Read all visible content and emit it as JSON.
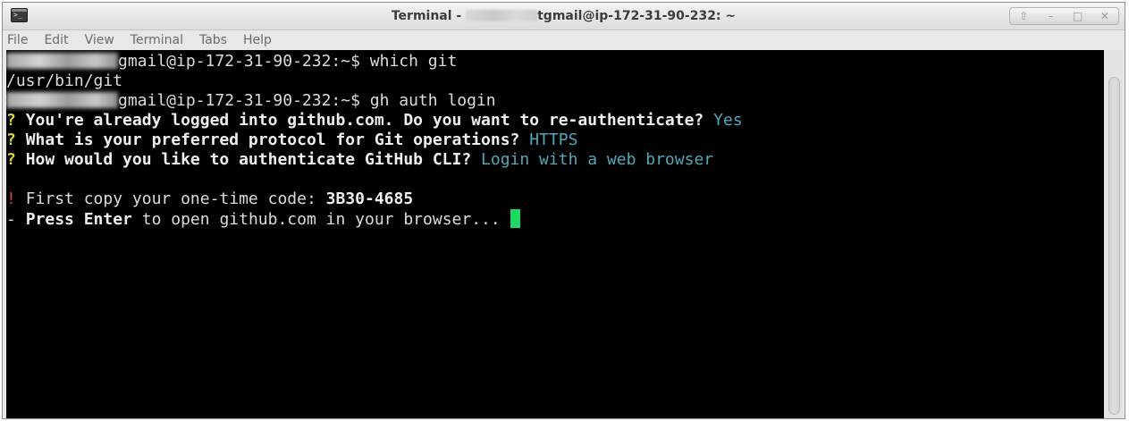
{
  "window": {
    "title_prefix": "Terminal - ",
    "title_suffix": "tgmail@ip-172-31-90-232: ~",
    "controls": [
      "⇧",
      "–",
      "□",
      "✕"
    ]
  },
  "menu": {
    "items": [
      "File",
      "Edit",
      "View",
      "Terminal",
      "Tabs",
      "Help"
    ]
  },
  "terminal": {
    "line1": {
      "prompt": "gmail@ip-172-31-90-232:~$ ",
      "command": "which git"
    },
    "line2": {
      "output": "/usr/bin/git"
    },
    "line3": {
      "prompt": "gmail@ip-172-31-90-232:~$ ",
      "command": "gh auth login"
    },
    "line4": {
      "mark": "?",
      "question": "You're already logged into github.com. Do you want to re-authenticate?",
      "answer": "Yes"
    },
    "line5": {
      "mark": "?",
      "question": "What is your preferred protocol for Git operations?",
      "answer": "HTTPS"
    },
    "line6": {
      "mark": "?",
      "question": "How would you like to authenticate GitHub CLI?",
      "answer": "Login with a web browser"
    },
    "line7": {
      "mark": "!",
      "text": "First copy your one-time code: ",
      "code": "3B30-4685"
    },
    "line8": {
      "mark": "-",
      "emphasis": "Press Enter",
      "text": " to open github.com in your browser... "
    }
  },
  "colors": {
    "terminal_bg": "#000000",
    "question_mark": "#d7d72e",
    "answer": "#4fa9b8",
    "warning": "#d04a3a",
    "cursor": "#1ed760"
  },
  "icons": {
    "app": "terminal-icon",
    "cursor": "block-cursor"
  }
}
